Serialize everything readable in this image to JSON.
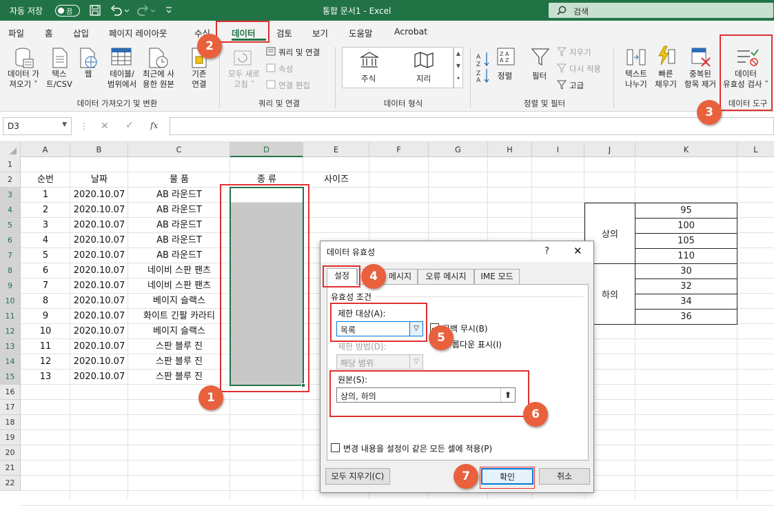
{
  "titlebar": {
    "autosave_label": "자동 저장",
    "autosave_state": "끔",
    "title": "통합 문서1  -  Excel",
    "search_placeholder": "검색"
  },
  "menu": {
    "tabs": [
      "파일",
      "홈",
      "삽입",
      "페이지 레이아웃",
      "수식",
      "데이터",
      "검토",
      "보기",
      "도움말",
      "Acrobat"
    ],
    "active": "데이터"
  },
  "ribbon": {
    "get_data": "데이터 가\n져오기 ˅",
    "text_csv": "텍스\n트/CSV",
    "web": "웹",
    "from_table": "테이블/\n범위에서",
    "recent_sources": "최근에 사\n용한 원본",
    "existing_conn": "기존\n연결",
    "refresh_all": "모두 새로\n고침 ˅",
    "queries_conn": "쿼리 및 연결",
    "properties": "속성",
    "edit_links": "연결 편집",
    "stocks": "주식",
    "geography": "지리",
    "sort": "정렬",
    "filter": "필터",
    "clear": "지우기",
    "reapply": "다시 적용",
    "advanced": "고급",
    "text_to_columns": "텍스트\n나누기",
    "flash_fill": "빠른\n채우기",
    "remove_dup": "중복된\n항목 제거",
    "data_validation": "데이터\n유효성 검사 ˅",
    "groups": {
      "get_transform": "데이터 가져오기 및 변환",
      "queries": "쿼리 및 연결",
      "data_types": "데이터 형식",
      "sort_filter": "정렬 및 필터",
      "data_tools": "데이터 도구"
    }
  },
  "formula_bar": {
    "name_box": "D3",
    "cancel": "✕",
    "enter": "✓",
    "fx": "fx",
    "formula": ""
  },
  "grid": {
    "columns": [
      "A",
      "B",
      "C",
      "D",
      "E",
      "F",
      "G",
      "H",
      "I",
      "J",
      "K",
      "L"
    ],
    "rows": [
      "1",
      "2",
      "3",
      "4",
      "5",
      "6",
      "7",
      "8",
      "9",
      "10",
      "11",
      "12",
      "13",
      "14",
      "15",
      "16",
      "17",
      "18",
      "19",
      "20",
      "21",
      "22"
    ],
    "headers": {
      "a": "순번",
      "b": "날짜",
      "c": "물 품",
      "d": "종 류",
      "e": "사이즈"
    },
    "data": [
      [
        "1",
        "2020.10.07",
        "AB 라운드T"
      ],
      [
        "2",
        "2020.10.07",
        "AB 라운드T"
      ],
      [
        "3",
        "2020.10.07",
        "AB 라운드T"
      ],
      [
        "4",
        "2020.10.07",
        "AB 라운드T"
      ],
      [
        "5",
        "2020.10.07",
        "AB 라운드T"
      ],
      [
        "6",
        "2020.10.07",
        "네이비 스판 팬츠"
      ],
      [
        "7",
        "2020.10.07",
        "네이비 스판 팬츠"
      ],
      [
        "8",
        "2020.10.07",
        "베이지 슬랙스"
      ],
      [
        "9",
        "2020.10.07",
        "화이트 긴팔 카라티"
      ],
      [
        "10",
        "2020.10.07",
        "베이지 슬랙스"
      ],
      [
        "11",
        "2020.10.07",
        "스판 블루 진"
      ],
      [
        "12",
        "2020.10.07",
        "스판 블루 진"
      ],
      [
        "13",
        "2020.10.07",
        "스판 블루 진"
      ]
    ],
    "size_table": {
      "top_label": "상의",
      "bottom_label": "하의",
      "top_sizes": [
        "95",
        "100",
        "105",
        "110"
      ],
      "bottom_sizes": [
        "30",
        "32",
        "34",
        "36"
      ]
    }
  },
  "dialog": {
    "title": "데이터 유효성",
    "help": "?",
    "close": "✕",
    "tabs": [
      "설정",
      "설명 메시지",
      "오류 메시지",
      "IME 모드"
    ],
    "tab_settings_visible": "설정",
    "tab_input_visible": "메시지",
    "section": "유효성 조건",
    "allow_label": "제한 대상(A):",
    "allow_value": "목록",
    "ignore_blank": "공백 무시(B)",
    "ignore_blank_visible": "공백 무시(B)",
    "in_cell_dropdown": "드롭다운 표시(I)",
    "in_cell_dropdown_visible": "롭다운 표시(I)",
    "data_label": "제한 방법(D):",
    "data_value": "해당 범위",
    "source_label": "원본(S):",
    "source_value": "상의, 하의",
    "apply_all": "변경 내용을 설정이 같은 모든 셀에 적용(P)",
    "clear_all": "모두 지우기(C)",
    "ok": "확인",
    "cancel": "취소"
  },
  "annotations": [
    "1",
    "2",
    "3",
    "4",
    "5",
    "6",
    "7"
  ],
  "colors": {
    "excel_green": "#217346",
    "annotation": "#e8603c",
    "highlight_red": "#e03030",
    "selection_gray": "#c8c8c8"
  }
}
